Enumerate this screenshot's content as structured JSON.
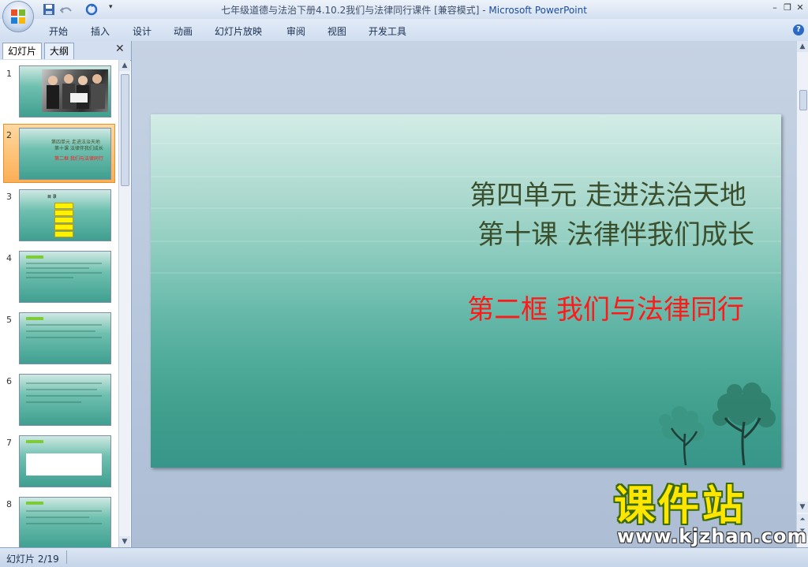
{
  "window": {
    "title_doc": "七年级道德与法治下册4.10.2我们与法律同行课件 [兼容模式] - ",
    "title_app": "Microsoft PowerPoint"
  },
  "ribbon": {
    "tabs": [
      "开始",
      "插入",
      "设计",
      "动画",
      "幻灯片放映",
      "审阅",
      "视图",
      "开发工具"
    ]
  },
  "pane": {
    "tabs": [
      "幻灯片",
      "大纲"
    ],
    "thumbnails": [
      "1",
      "2",
      "3",
      "4",
      "5",
      "6",
      "7",
      "8"
    ],
    "thumb2_lines": [
      "第四单元 走进法治天地",
      "第十课 法律伴我们成长",
      "第二框 我们与法律同行"
    ],
    "thumb3_title": "目 录"
  },
  "slide": {
    "title_line1": "第四单元 走进法治天地",
    "title_line2": "第十课 法律伴我们成长",
    "subtitle": "第二框 我们与法律同行"
  },
  "status": {
    "text": "幻灯片 2/19"
  },
  "watermark": {
    "title": "课件站",
    "url": "www.kjzhan.com"
  },
  "colors": {
    "slide_title": "#3a4f2d",
    "slide_subtitle": "#ff1a1a",
    "selected_thumb": "#fbae55"
  }
}
